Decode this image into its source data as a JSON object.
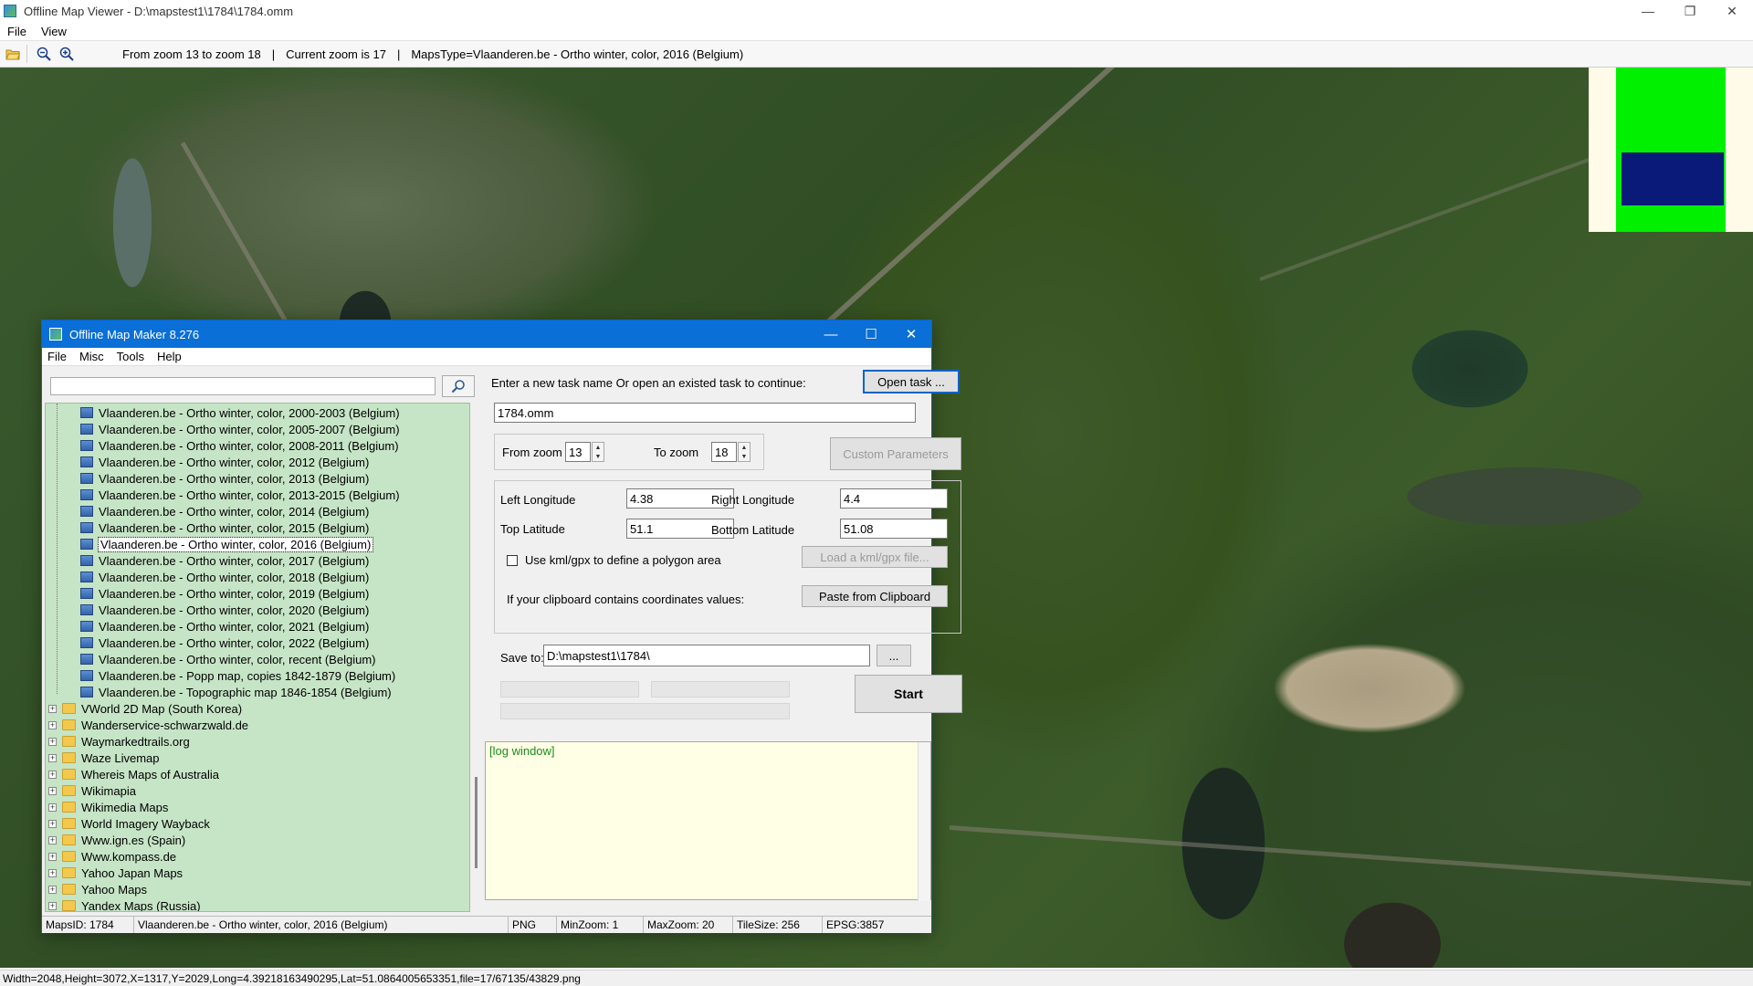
{
  "window": {
    "title": "Offline Map Viewer - D:\\mapstest1\\1784\\1784.omm",
    "controls": [
      "—",
      "❐",
      "✕"
    ]
  },
  "menu": [
    "File",
    "View"
  ],
  "toolbar": {
    "zoom_range": "From zoom 13 to zoom 18",
    "separator": "|",
    "current_zoom": "Current zoom is 17",
    "separator2": "|",
    "maps_type": "MapsType=Vlaanderen.be - Ortho winter, color, 2016 (Belgium)"
  },
  "statusbar": {
    "text": "Width=2048,Height=3072,X=1317,Y=2029,Long=4.39218163490295,Lat=51.0864005653351,file=17/67135/43829.png"
  },
  "minimap": {
    "outer": "#fffbe8",
    "green": "#00f000",
    "blue": "#0a1a78"
  },
  "dialog": {
    "title": "Offline Map Maker 8.276",
    "controls": [
      "—",
      "☐",
      "✕"
    ],
    "menu": [
      "File",
      "Misc",
      "Tools",
      "Help"
    ],
    "search": {
      "value": "",
      "placeholder": ""
    },
    "tree": {
      "children": [
        "Vlaanderen.be - Ortho winter, color, 2000-2003 (Belgium)",
        "Vlaanderen.be - Ortho winter, color, 2005-2007 (Belgium)",
        "Vlaanderen.be - Ortho winter, color, 2008-2011 (Belgium)",
        "Vlaanderen.be - Ortho winter, color, 2012 (Belgium)",
        "Vlaanderen.be - Ortho winter, color, 2013 (Belgium)",
        "Vlaanderen.be - Ortho winter, color, 2013-2015 (Belgium)",
        "Vlaanderen.be - Ortho winter, color, 2014 (Belgium)",
        "Vlaanderen.be - Ortho winter, color, 2015 (Belgium)",
        "Vlaanderen.be - Ortho winter, color, 2016 (Belgium)",
        "Vlaanderen.be - Ortho winter, color, 2017 (Belgium)",
        "Vlaanderen.be - Ortho winter, color, 2018 (Belgium)",
        "Vlaanderen.be - Ortho winter, color, 2019 (Belgium)",
        "Vlaanderen.be - Ortho winter, color, 2020 (Belgium)",
        "Vlaanderen.be - Ortho winter, color, 2021 (Belgium)",
        "Vlaanderen.be - Ortho winter, color, 2022 (Belgium)",
        "Vlaanderen.be - Ortho winter, color, recent (Belgium)",
        "Vlaanderen.be - Popp map, copies 1842-1879 (Belgium)",
        "Vlaanderen.be - Topographic map 1846-1854 (Belgium)"
      ],
      "selected_index": 8,
      "folders": [
        "VWorld 2D Map (South Korea)",
        "Wanderservice-schwarzwald.de",
        "Waymarkedtrails.org",
        "Waze Livemap",
        "Whereis Maps of Australia",
        "Wikimapia",
        "Wikimedia Maps",
        "World Imagery Wayback",
        "Www.ign.es (Spain)",
        "Www.kompass.de",
        "Yahoo Japan Maps",
        "Yahoo Maps",
        "Yandex Maps (Russia)"
      ],
      "expander": "+"
    },
    "task": {
      "prompt": "Enter a new task name Or open an existed task to continue:",
      "open_button": "Open task ...",
      "name_value": "1784.omm"
    },
    "zoom": {
      "from_label": "From zoom",
      "from_value": "13",
      "to_label": "To zoom",
      "to_value": "18",
      "custom_button": "Custom Parameters"
    },
    "coords": {
      "left_lon_label": "Left Longitude",
      "left_lon_value": "4.38",
      "right_lon_label": "Right Longitude",
      "right_lon_value": "4.4",
      "top_lat_label": "Top Latitude",
      "top_lat_value": "51.1",
      "bottom_lat_label": "Bottom Latitude",
      "bottom_lat_value": "51.08",
      "kml_label": "Use kml/gpx to define a polygon area",
      "kml_button": "Load a kml/gpx file...",
      "clipboard_label": "If your clipboard contains coordinates values:",
      "clipboard_button": "Paste from Clipboard"
    },
    "save": {
      "label": "Save to:",
      "value": "D:\\mapstest1\\1784\\",
      "browse_button": "...",
      "start_button": "Start"
    },
    "log": {
      "text": "[log window]"
    },
    "status": {
      "maps_id": "MapsID: 1784",
      "maps_name": "Vlaanderen.be - Ortho winter, color, 2016 (Belgium)",
      "format": "PNG",
      "min_zoom": "MinZoom: 1",
      "max_zoom": "MaxZoom: 20",
      "tile_size": "TileSize: 256",
      "epsg": "EPSG:3857"
    }
  }
}
